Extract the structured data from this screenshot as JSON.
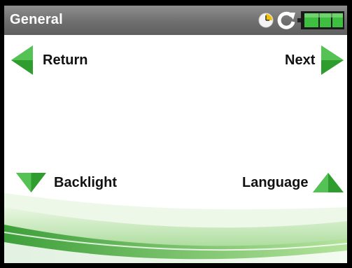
{
  "header": {
    "title": "General",
    "status_icons": [
      "clock-icon",
      "refresh-icon",
      "battery-icon"
    ]
  },
  "nav": {
    "return_label": "Return",
    "next_label": "Next",
    "backlight_label": "Backlight",
    "language_label": "Language"
  },
  "colors": {
    "titlebar": "#7a7a7a",
    "arrow_green": "#2e9d2e",
    "battery_green": "#3fbf3f"
  }
}
